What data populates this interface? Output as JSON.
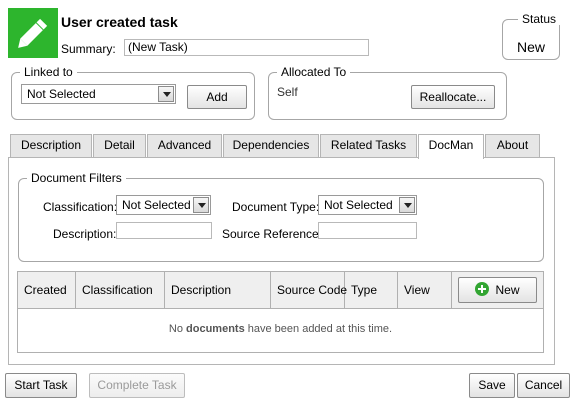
{
  "header": {
    "title": "User created task",
    "summary_label": "Summary:",
    "summary_value": "(New Task)",
    "icon": "pencil-icon"
  },
  "status": {
    "legend": "Status",
    "value": "New"
  },
  "linked_to": {
    "legend": "Linked to",
    "selected": "Not Selected",
    "add_button": "Add"
  },
  "allocated_to": {
    "legend": "Allocated To",
    "value": "Self",
    "reallocate_button": "Reallocate..."
  },
  "tabs": [
    {
      "label": "Description"
    },
    {
      "label": "Detail"
    },
    {
      "label": "Advanced"
    },
    {
      "label": "Dependencies"
    },
    {
      "label": "Related Tasks"
    },
    {
      "label": "DocMan",
      "active": true
    },
    {
      "label": "About"
    }
  ],
  "filters": {
    "legend": "Document Filters",
    "classification_label": "Classification:",
    "classification_value": "Not Selected",
    "document_type_label": "Document Type:",
    "document_type_value": "Not Selected",
    "description_label": "Description:",
    "description_value": "",
    "source_reference_label": "Source Reference:",
    "source_reference_value": ""
  },
  "documents_table": {
    "columns": [
      "Created",
      "Classification",
      "Description",
      "Source Code",
      "Type",
      "View"
    ],
    "new_button": "New",
    "empty_message_prefix": "No ",
    "empty_message_bold": "documents",
    "empty_message_suffix": " have been added at this time."
  },
  "footer": {
    "start_task": "Start Task",
    "complete_task": "Complete Task",
    "save": "Save",
    "cancel": "Cancel"
  },
  "colors": {
    "icon_background": "#2db52d",
    "new_icon": "#32a532"
  }
}
